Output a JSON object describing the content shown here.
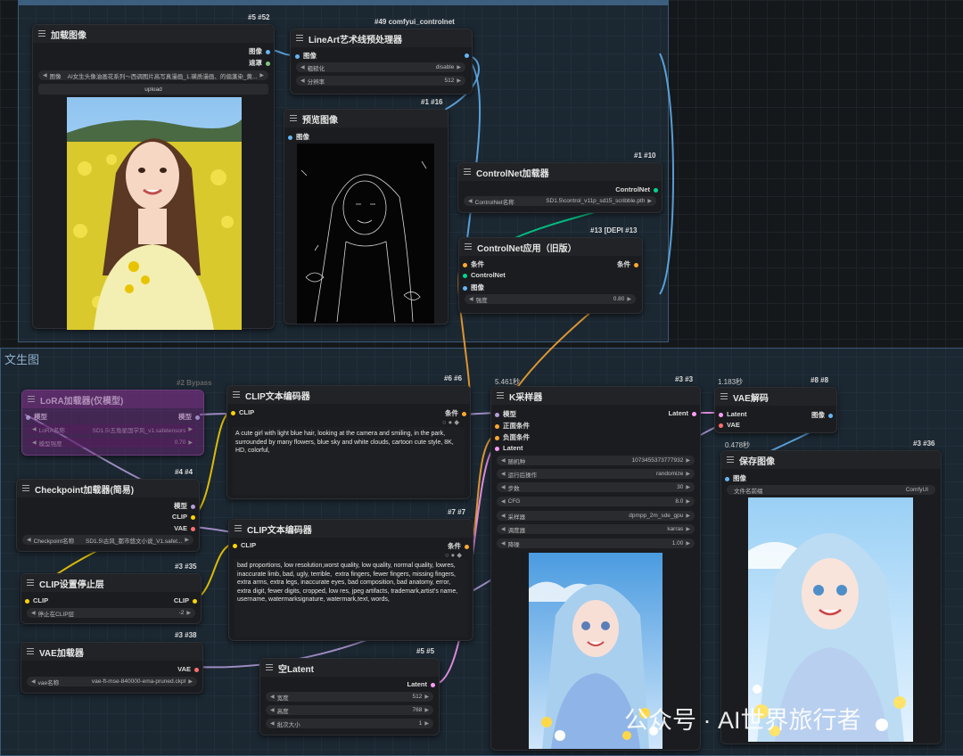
{
  "groups": {
    "bottom_title": "文生图"
  },
  "colors": {
    "image": "#64b5f6",
    "mask": "#81c784",
    "model": "#b39ddb",
    "clip": "#ffd500",
    "vae": "#ff6e6e",
    "conditioning": "#ffa931",
    "controlnet": "#00d78d",
    "latent": "#ff9cf9"
  },
  "top_badges": {
    "n49_top": "#49 comfyui_controlnet"
  },
  "nodes": {
    "load_image": {
      "title": "加载图像",
      "badge": "#5 #52",
      "out_image": "图像",
      "out_mask": "遮罩",
      "w_label": "图像",
      "w_value": "AI女生头像油画花系列～西调图片高写真漫画_1.磺质漫画、的偏蓬染_黄...",
      "upload": "upload"
    },
    "lineart": {
      "title": "LineArt艺术线预处理器",
      "in_image": "图像",
      "w1_label": "粗糙化",
      "w1_value": "disable",
      "w2_label": "分辨率",
      "w2_value": "512"
    },
    "preview": {
      "title": "预览图像",
      "badge": "#1 #16",
      "in_image": "图像"
    },
    "cn_loader": {
      "title": "ControlNet加载器",
      "badge": "#1 #10",
      "out": "ControlNet",
      "w_label": "ControlNet名称",
      "w_value": "SD1.5\\control_v11p_sd15_scribble.pth"
    },
    "cn_apply": {
      "title": "ControlNet应用（旧版）",
      "badge": "#13 [DEPI #13",
      "in_cond": "条件",
      "out_cond": "条件",
      "in_cn": "ControlNet",
      "in_image": "图像",
      "w_label": "强度",
      "w_value": "0.80"
    },
    "lora": {
      "title": "LoRA加载器(仅模型)",
      "badge": "#2 Bypass",
      "in_model": "模型",
      "out_model": "模型",
      "w1_label": "LoRA名称",
      "w1_value": "SD1.5\\五角星国学风_v1.safetensors",
      "w2_label": "模型强度",
      "w2_value": "0.70"
    },
    "ckpt": {
      "title": "Checkpoint加载器(简易)",
      "badge": "#4 #4",
      "out_model": "模型",
      "out_clip": "CLIP",
      "out_vae": "VAE",
      "w_label": "Checkpoint名称",
      "w_value": "SD1.5\\古风_都市悠文小说_V1.safet..."
    },
    "clip_skip": {
      "title": "CLIP设置停止层",
      "badge": "#3 #35",
      "in": "CLIP",
      "out": "CLIP",
      "w_label": "停止在CLIP层",
      "w_value": "-2"
    },
    "vae_loader": {
      "title": "VAE加载器",
      "badge": "#3 #38",
      "out": "VAE",
      "w_label": "vae名称",
      "w_value": "vae-ft-mse-840000-ema-pruned.ckpt"
    },
    "clip_pos": {
      "title": "CLIP文本编码器",
      "badge": "#6 #6",
      "in": "CLIP",
      "out": "条件",
      "text": "A cute girl with light blue hair, looking at the camera and smiling, in the park, surrounded by many flowers, blue sky and white clouds, cartoon cute style, 8K, HD, colorful,"
    },
    "clip_neg": {
      "title": "CLIP文本编码器",
      "badge": "#7 #7",
      "in": "CLIP",
      "out": "条件",
      "text": "bad proportions, low resolution,worst quality, low quality, normal quality, lowres,  inaccurate limb, bad, ugly, terrible,  extra fingers, fewer fingers, missing fingers, extra arms, extra legs, inaccurate eyes, bad composition, bad anatomy, error, extra digit, fewer digits, cropped, low res, jpeg artifacts, trademark,artist's name, username, watermarksignature, watermark,text, words,"
    },
    "empty_latent": {
      "title": "空Latent",
      "badge": "#5 #5",
      "out": "Latent",
      "w1_label": "宽度",
      "w1_value": "512",
      "w2_label": "高度",
      "w2_value": "768",
      "w3_label": "批次大小",
      "w3_value": "1"
    },
    "ksampler": {
      "title": "K采样器",
      "badge": "#3 #3",
      "timing": "5.461秒",
      "in_model": "模型",
      "in_pos": "正面条件",
      "in_neg": "负面条件",
      "in_latent": "Latent",
      "out": "Latent",
      "widgets": [
        {
          "label": "随机种",
          "value": "1073455373777932"
        },
        {
          "label": "运行后操作",
          "value": "randomize"
        },
        {
          "label": "步数",
          "value": "30"
        },
        {
          "label": "CFG",
          "value": "8.0"
        },
        {
          "label": "采样器",
          "value": "dpmpp_2m_sde_gpu"
        },
        {
          "label": "调度器",
          "value": "karras"
        },
        {
          "label": "降噪",
          "value": "1.00"
        }
      ]
    },
    "vae_decode": {
      "title": "VAE解码",
      "badge": "#8 #8",
      "timing": "1.183秒",
      "in_latent": "Latent",
      "in_vae": "VAE",
      "out": "图像"
    },
    "save": {
      "title": "保存图像",
      "badge": "#3 #36",
      "timing": "0.478秒",
      "in_image": "图像",
      "w_label": "文件名前缀",
      "w_value": "ComfyUI"
    }
  },
  "watermark": "公众号 · AI世界旅行者"
}
